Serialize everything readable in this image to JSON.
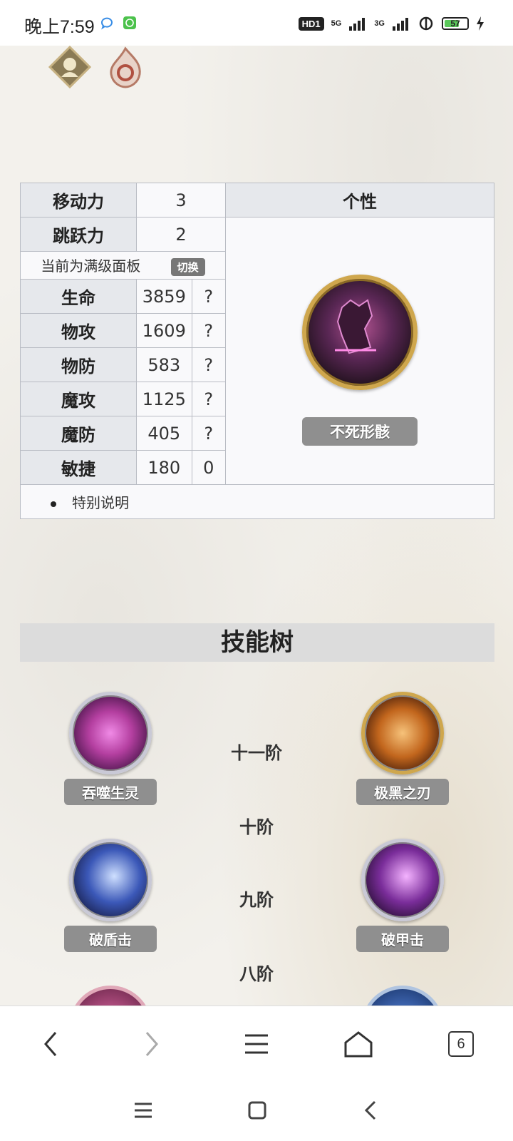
{
  "status_bar": {
    "time": "晚上7:59",
    "hd_badge": "HD1",
    "net1": "5G",
    "net2": "3G",
    "battery": "57"
  },
  "stats": {
    "move_label": "移动力",
    "move_value": "3",
    "jump_label": "跳跃力",
    "jump_value": "2",
    "trait_header": "个性",
    "panel_note": "当前为满级面板",
    "switch_label": "切换",
    "rows": [
      {
        "label": "生命",
        "value": "3859",
        "extra": "?"
      },
      {
        "label": "物攻",
        "value": "1609",
        "extra": "?"
      },
      {
        "label": "物防",
        "value": "583",
        "extra": "?"
      },
      {
        "label": "魔攻",
        "value": "1125",
        "extra": "?"
      },
      {
        "label": "魔防",
        "value": "405",
        "extra": "?"
      },
      {
        "label": "敏捷",
        "value": "180",
        "extra": "0"
      }
    ],
    "trait_name": "不死形骸",
    "special_note": "特别说明"
  },
  "skill_tree": {
    "title": "技能树",
    "tiers": [
      "十一阶",
      "十阶",
      "九阶",
      "八阶"
    ],
    "skills": [
      {
        "name": "吞噬生灵",
        "color": "#b43fa0"
      },
      {
        "name": "极黑之刃",
        "color": "#c2661d"
      },
      {
        "name": "破盾击",
        "color": "#3b58b8"
      },
      {
        "name": "破甲击",
        "color": "#7a2d9a"
      }
    ]
  },
  "browser_nav": {
    "tab_count": "6"
  }
}
